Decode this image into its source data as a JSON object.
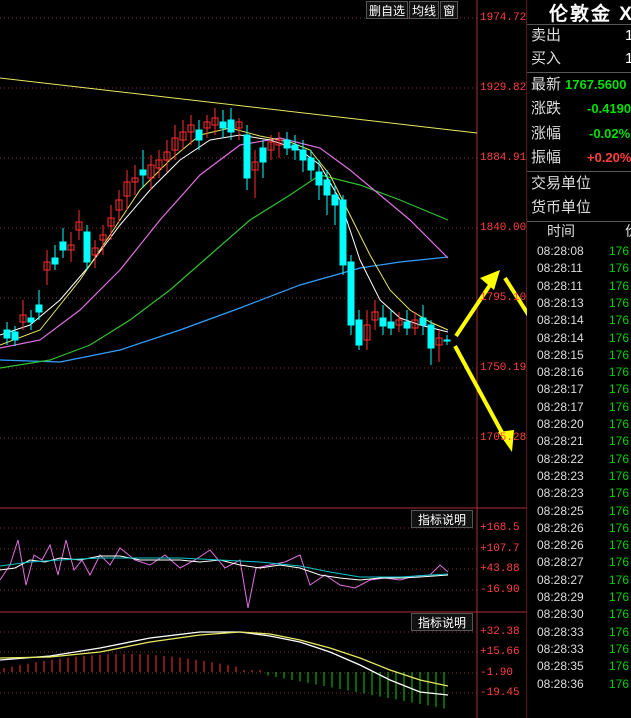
{
  "toolbar": {
    "add_watch": "删自选",
    "avg_line": "均线",
    "window": "窗"
  },
  "price_axis": [
    "1974.727",
    "1929.820",
    "1884.914",
    "1840.008",
    "1795.101",
    "1750.195",
    "1705.289"
  ],
  "indicator1": {
    "button": "指标说明",
    "labels": [
      "+168.5",
      "+107.7",
      "+43.88",
      "-16.90"
    ]
  },
  "indicator2": {
    "button": "指标说明",
    "labels": [
      "+32.38",
      "+15.66",
      "-1.90",
      "-19.45"
    ]
  },
  "quote": {
    "title": "伦敦金 X",
    "sell_label": "卖出",
    "sell_value": "1",
    "buy_label": "买入",
    "buy_value": "1",
    "latest_label": "最新",
    "latest_value": "1767.5600",
    "change_label": "涨跌",
    "change_value": "-0.4190",
    "change_pct_label": "涨幅",
    "change_pct_value": "-0.02%",
    "amplitude_label": "振幅",
    "amplitude_value": "+0.20%",
    "trade_unit_label": "交易单位",
    "currency_unit_label": "货币单位",
    "ticks_header_time": "时间",
    "ticks_header_price": "价",
    "ticks": [
      {
        "time": "08:28:08",
        "price": "176"
      },
      {
        "time": "08:28:11",
        "price": "176"
      },
      {
        "time": "08:28:11",
        "price": "176"
      },
      {
        "time": "08:28:13",
        "price": "176"
      },
      {
        "time": "08:28:14",
        "price": "176"
      },
      {
        "time": "08:28:14",
        "price": "176"
      },
      {
        "time": "08:28:15",
        "price": "176"
      },
      {
        "time": "08:28:16",
        "price": "176"
      },
      {
        "time": "08:28:17",
        "price": "176"
      },
      {
        "time": "08:28:17",
        "price": "176"
      },
      {
        "time": "08:28:20",
        "price": "176"
      },
      {
        "time": "08:28:21",
        "price": "176"
      },
      {
        "time": "08:28:22",
        "price": "176"
      },
      {
        "time": "08:28:23",
        "price": "176"
      },
      {
        "time": "08:28:23",
        "price": "176"
      },
      {
        "time": "08:28:25",
        "price": "176"
      },
      {
        "time": "08:28:26",
        "price": "176"
      },
      {
        "time": "08:28:26",
        "price": "176"
      },
      {
        "time": "08:28:27",
        "price": "176"
      },
      {
        "time": "08:28:27",
        "price": "176"
      },
      {
        "time": "08:28:29",
        "price": "176"
      },
      {
        "time": "08:28:30",
        "price": "176"
      },
      {
        "time": "08:28:33",
        "price": "176"
      },
      {
        "time": "08:28:33",
        "price": "176"
      },
      {
        "time": "08:28:35",
        "price": "176"
      },
      {
        "time": "08:28:36",
        "price": "176"
      }
    ]
  },
  "colors": {
    "up": "#ff3030",
    "down": "#00ffff",
    "trendline": "#e8e860",
    "arrows": "#ffff00"
  }
}
